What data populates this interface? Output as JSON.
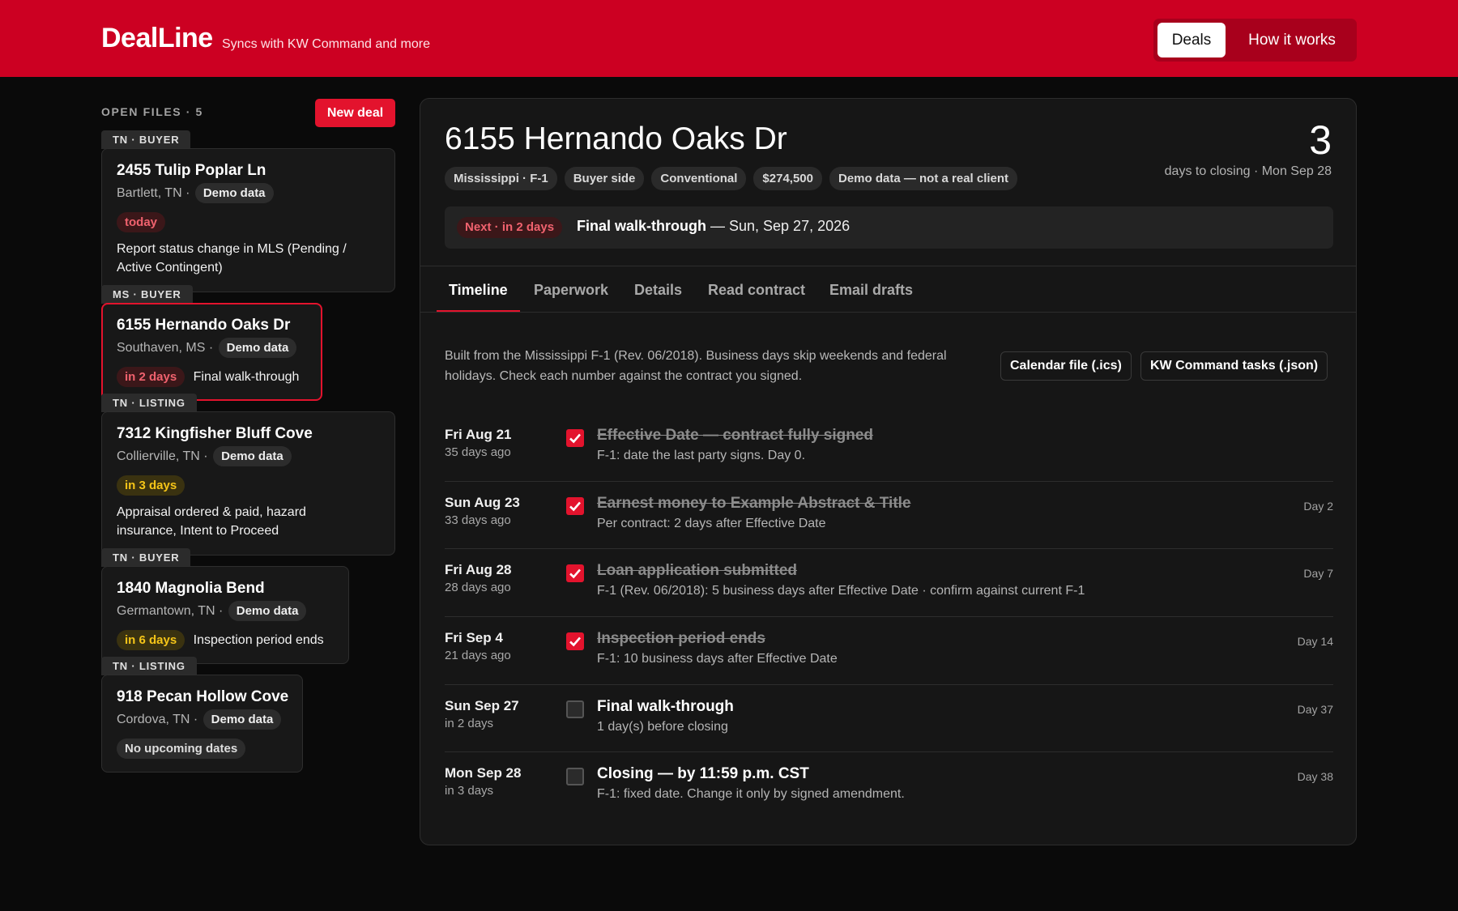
{
  "header": {
    "brand": "DealLine",
    "tagline": "Syncs with KW Command and more",
    "nav": [
      "Deals",
      "How it works"
    ]
  },
  "sidebar": {
    "heading": "OPEN FILES · 5",
    "new_deal_label": "New deal",
    "deals": [
      {
        "tag": "TN · BUYER",
        "name": "2455 Tulip Poplar Ln",
        "location": "Bartlett, TN ·",
        "demo": "Demo data",
        "due": "today",
        "task": "Report status change in MLS (Pending / Active Contingent)"
      },
      {
        "tag": "MS · BUYER",
        "name": "6155 Hernando Oaks Dr",
        "location": "Southaven, MS ·",
        "demo": "Demo data",
        "due": "in 2 days",
        "task": "Final walk-through"
      },
      {
        "tag": "TN · LISTING",
        "name": "7312 Kingfisher Bluff Cove",
        "location": "Collierville, TN ·",
        "demo": "Demo data",
        "due": "in 3 days",
        "task": "Appraisal ordered & paid, hazard insurance, Intent to Proceed"
      },
      {
        "tag": "TN · BUYER",
        "name": "1840 Magnolia Bend",
        "location": "Germantown, TN ·",
        "demo": "Demo data",
        "due": "in 6 days",
        "task": "Inspection period ends"
      },
      {
        "tag": "TN · LISTING",
        "name": "918 Pecan Hollow Cove",
        "location": "Cordova, TN ·",
        "demo": "Demo data",
        "due": "No upcoming dates",
        "task": ""
      }
    ]
  },
  "deal": {
    "title": "6155 Hernando Oaks Dr",
    "chips": [
      "Mississippi · F-1",
      "Buyer side",
      "Conventional",
      "$274,500",
      "Demo data — not a real client"
    ],
    "days_to_closing": "3",
    "days_sub": "days to closing · Mon Sep 28",
    "next_pill": "Next · in 2 days",
    "next_title": "Final walk-through",
    "next_date": " — Sun, Sep 27, 2026",
    "tabs": [
      "Timeline",
      "Paperwork",
      "Details",
      "Read contract",
      "Email drafts"
    ],
    "note": "Built from the Mississippi F-1 (Rev. 06/2018). Business days skip weekends and federal holidays. Check each number against the contract you signed.",
    "export_buttons": [
      "Calendar file (.ics)",
      "KW Command tasks (.json)"
    ],
    "timeline": [
      {
        "date": "Fri Aug 21",
        "ago": "35 days ago",
        "done": true,
        "title": "Effective Date — contract fully signed",
        "sub": "F-1: date the last party signs. Day 0.",
        "day": ""
      },
      {
        "date": "Sun Aug 23",
        "ago": "33 days ago",
        "done": true,
        "title": "Earnest money to Example Abstract & Title",
        "sub": "Per contract: 2 days after Effective Date",
        "day": "Day 2"
      },
      {
        "date": "Fri Aug 28",
        "ago": "28 days ago",
        "done": true,
        "title": "Loan application submitted",
        "sub": "F-1 (Rev. 06/2018): 5 business days after Effective Date · confirm against current F-1",
        "day": "Day 7"
      },
      {
        "date": "Fri Sep 4",
        "ago": "21 days ago",
        "done": true,
        "title": "Inspection period ends",
        "sub": "F-1: 10 business days after Effective Date",
        "day": "Day 14"
      },
      {
        "date": "Sun Sep 27",
        "ago": "in 2 days",
        "done": false,
        "title": "Final walk-through",
        "sub": "1 day(s) before closing",
        "day": "Day 37"
      },
      {
        "date": "Mon Sep 28",
        "ago": "in 3 days",
        "done": false,
        "title": "Closing — by 11:59 p.m. CST",
        "sub": "F-1: fixed date. Change it only by signed amendment.",
        "day": "Day 38"
      }
    ]
  }
}
